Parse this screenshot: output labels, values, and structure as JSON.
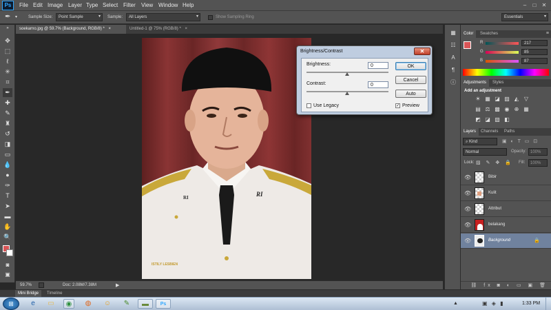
{
  "app": {
    "logo": "Ps"
  },
  "menu": [
    "File",
    "Edit",
    "Image",
    "Layer",
    "Type",
    "Select",
    "Filter",
    "View",
    "Window",
    "Help"
  ],
  "window_controls": [
    "–",
    "□",
    "✕"
  ],
  "options": {
    "sample_size_label": "Sample Size:",
    "sample_size_value": "Point Sample",
    "sample_label": "Sample:",
    "sample_value": "All Layers",
    "show_ring_label": "Show Sampling Ring",
    "workspace": "Essentials"
  },
  "tabs": [
    {
      "label": "soekarno.jpg @ 59.7% (Background, RGB/8) *",
      "close": "×"
    },
    {
      "label": "Untitled-1 @ 75% (RGB/8) *",
      "close": "×"
    }
  ],
  "photo": {
    "shoulder_text": "RI",
    "shoulder_text_right": "RI",
    "signature": "ISTILY LESBIEN"
  },
  "status": {
    "zoom": "59.7%",
    "doc": "Doc: 2.08M/7.38M"
  },
  "bottom_tabs": [
    "Mini Bridge",
    "Timeline"
  ],
  "color_panel": {
    "tabs": [
      "Color",
      "Swatches"
    ],
    "channels": [
      {
        "label": "R",
        "value": "217"
      },
      {
        "label": "G",
        "value": "85"
      },
      {
        "label": "B",
        "value": "87"
      }
    ],
    "foreground": "#d95557"
  },
  "adjustments_panel": {
    "tabs": [
      "Adjustments",
      "Styles"
    ],
    "heading": "Add an adjustment",
    "icons_row1": [
      "☀",
      "▦",
      "◪",
      "▨",
      "◭",
      "▽"
    ],
    "icons_row2": [
      "▤",
      "⚖",
      "▩",
      "◉",
      "⊕",
      "▦"
    ],
    "icons_row3": [
      "◩",
      "◪",
      "▧",
      "◧"
    ]
  },
  "layers_panel": {
    "tabs": [
      "Layers",
      "Channels",
      "Paths"
    ],
    "kind": "Kind",
    "blend_mode": "Normal",
    "opacity_label": "Opacity:",
    "opacity_value": "100%",
    "lock_label": "Lock:",
    "fill_label": "Fill:",
    "fill_value": "100%",
    "layers": [
      {
        "name": "Bibir",
        "selected": false
      },
      {
        "name": "Kulit",
        "selected": false
      },
      {
        "name": "Attribut",
        "selected": false
      },
      {
        "name": "belakang",
        "selected": false
      },
      {
        "name": "Background",
        "selected": true
      }
    ]
  },
  "dialog": {
    "title": "Brightness/Contrast",
    "brightness_label": "Brightness:",
    "brightness_value": "0",
    "contrast_label": "Contrast:",
    "contrast_value": "0",
    "ok": "OK",
    "cancel": "Cancel",
    "auto": "Auto",
    "use_legacy": "Use Legacy",
    "preview": "Preview",
    "preview_checked": "✓"
  },
  "taskbar": {
    "time": "1:33 PM"
  }
}
